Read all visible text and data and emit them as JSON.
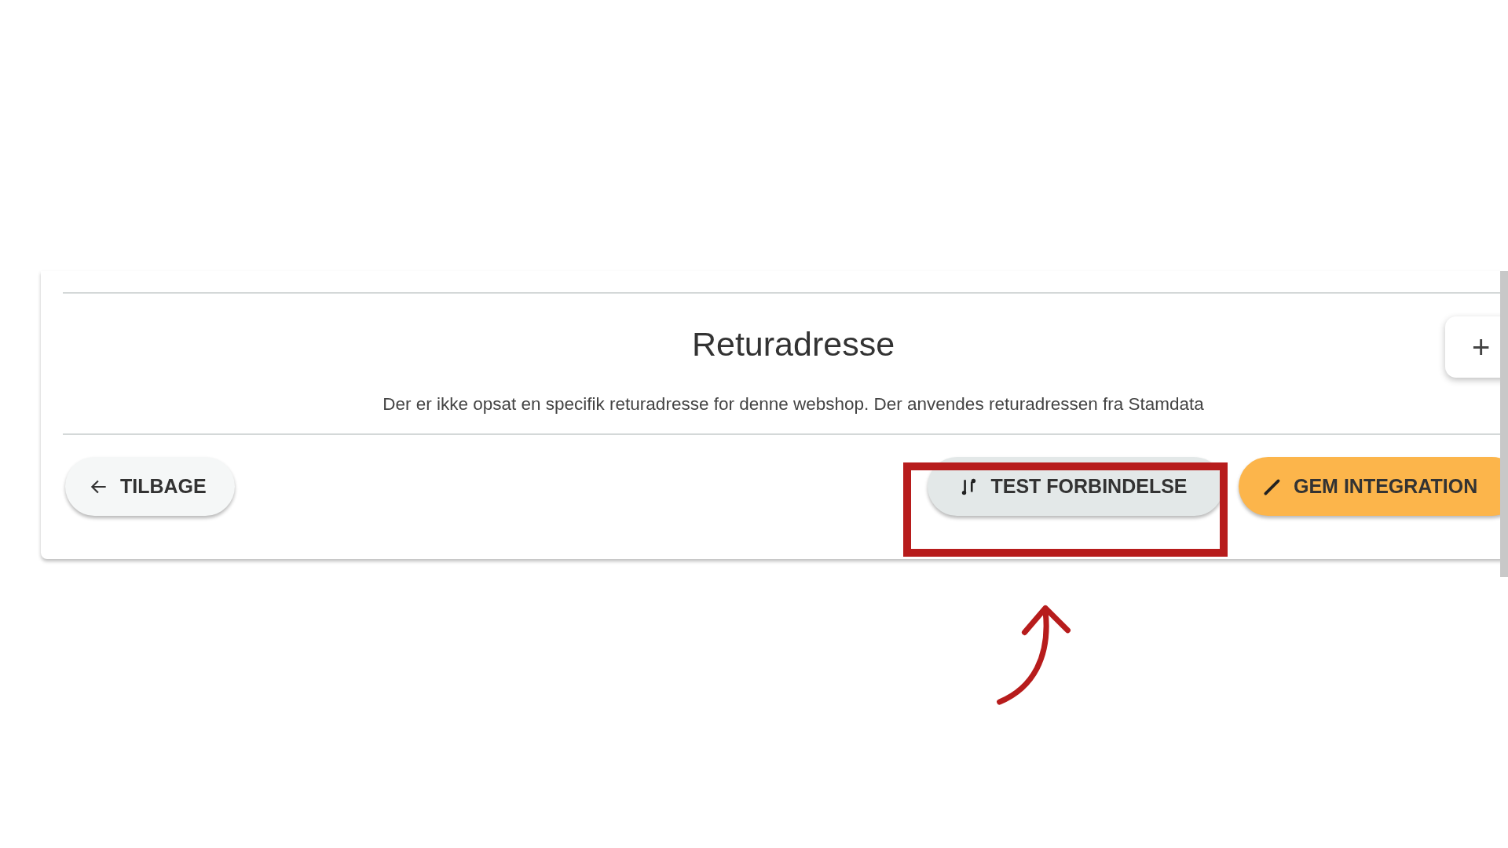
{
  "section": {
    "title": "Returadresse",
    "description": "Der er ikke opsat en specifik returadresse for denne webshop. Der anvendes returadressen fra Stamdata",
    "add_button": {
      "label": "+"
    }
  },
  "actions": [
    {
      "kind": "back",
      "label": "TILBAGE"
    },
    {
      "kind": "test",
      "label": "TEST FORBINDELSE"
    },
    {
      "kind": "save",
      "label": "GEM INTEGRATION"
    }
  ]
}
